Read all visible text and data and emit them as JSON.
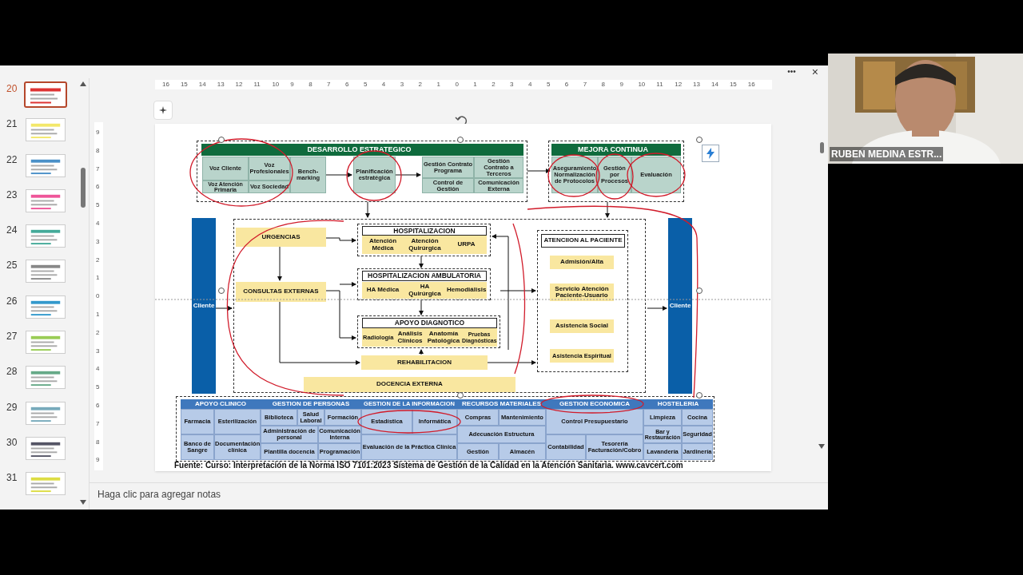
{
  "toolbar": {
    "more": "•••",
    "close": "×"
  },
  "thumbnails": [
    {
      "number": "20",
      "selected": true
    },
    {
      "number": "21",
      "selected": false
    },
    {
      "number": "22",
      "selected": false
    },
    {
      "number": "23",
      "selected": false
    },
    {
      "number": "24",
      "selected": false
    },
    {
      "number": "25",
      "selected": false
    },
    {
      "number": "26",
      "selected": false
    },
    {
      "number": "27",
      "selected": false
    },
    {
      "number": "28",
      "selected": false
    },
    {
      "number": "29",
      "selected": false
    },
    {
      "number": "30",
      "selected": false
    },
    {
      "number": "31",
      "selected": false
    }
  ],
  "ruler": {
    "horizontal": [
      "16",
      "15",
      "14",
      "13",
      "12",
      "11",
      "10",
      "9",
      "8",
      "7",
      "6",
      "5",
      "4",
      "3",
      "2",
      "1",
      "0",
      "1",
      "2",
      "3",
      "4",
      "5",
      "6",
      "7",
      "8",
      "9",
      "10",
      "11",
      "12",
      "13",
      "14",
      "15",
      "16"
    ],
    "vertical": [
      "9",
      "8",
      "7",
      "6",
      "5",
      "4",
      "3",
      "2",
      "1",
      "0",
      "1",
      "2",
      "3",
      "4",
      "5",
      "6",
      "7",
      "8",
      "9"
    ]
  },
  "diagram": [
    {
      "kind": "band-green",
      "text": "DESARROLLO ESTRATEGICO"
    },
    {
      "kind": "teal",
      "text": "Voz Cliente"
    },
    {
      "kind": "teal",
      "text": "Voz Profesionales"
    },
    {
      "kind": "teal",
      "text": "Voz Atención Primaria"
    },
    {
      "kind": "teal",
      "text": "Voz Sociedad"
    },
    {
      "kind": "teal",
      "text": "Bench-marking"
    },
    {
      "kind": "teal",
      "text": "Planificación estratégica"
    },
    {
      "kind": "teal",
      "text": "Gestión Contrato Programa"
    },
    {
      "kind": "teal",
      "text": "Gestión Contrato a Terceros"
    },
    {
      "kind": "teal",
      "text": "Control de Gestión"
    },
    {
      "kind": "teal",
      "text": "Comunicación Externa"
    },
    {
      "kind": "band-green",
      "text": "MEJORA CONTINUA"
    },
    {
      "kind": "teal",
      "text": "Aseguramiento Normalización de Protocolos"
    },
    {
      "kind": "teal",
      "text": "Gestión por Procesos"
    },
    {
      "kind": "teal",
      "text": "Evaluación"
    },
    {
      "kind": "client",
      "text": "Cliente"
    },
    {
      "kind": "client",
      "text": "Cliente"
    },
    {
      "kind": "yellow",
      "text": "URGENCIAS"
    },
    {
      "kind": "yellow",
      "text": "CONSULTAS EXTERNAS"
    },
    {
      "kind": "title",
      "text": "HOSPITALIZACION"
    },
    {
      "kind": "yellow",
      "text": "Atención Médica"
    },
    {
      "kind": "yellow",
      "text": "Atención Quirúrgica"
    },
    {
      "kind": "yellow",
      "text": "URPA"
    },
    {
      "kind": "title",
      "text": "HOSPITALIZACION AMBULATORIA"
    },
    {
      "kind": "yellow",
      "text": "HA Médica"
    },
    {
      "kind": "yellow",
      "text": "HA Quirúrgica"
    },
    {
      "kind": "yellow",
      "text": "Hemodiálisis"
    },
    {
      "kind": "title",
      "text": "APOYO DIAGNOTICO"
    },
    {
      "kind": "yellow",
      "text": "Radiología"
    },
    {
      "kind": "yellow",
      "text": "Análisis Clínicos"
    },
    {
      "kind": "yellow",
      "text": "Anatomía Patológica"
    },
    {
      "kind": "yellow",
      "text": "Pruebas Diagnósticas"
    },
    {
      "kind": "yellow",
      "text": "REHABILITACION"
    },
    {
      "kind": "yellow",
      "text": "DOCENCIA EXTERNA"
    },
    {
      "kind": "title",
      "text": "ATENCIION AL PACIENTE"
    },
    {
      "kind": "yellow",
      "text": "Admisión/Alta"
    },
    {
      "kind": "yellow",
      "text": "Servicio Atención Paciente-Usuario"
    },
    {
      "kind": "yellow",
      "text": "Asistencia Social"
    },
    {
      "kind": "yellow",
      "text": "Asistencia Espiritual"
    },
    {
      "kind": "band-blue",
      "text": "APOYO CLINICO"
    },
    {
      "kind": "band-blue",
      "text": "GESTION DE PERSONAS"
    },
    {
      "kind": "band-blue",
      "text": "GESTION DE LA INFORMACION"
    },
    {
      "kind": "band-blue",
      "text": "RECURSOS MATERIALES"
    },
    {
      "kind": "band-blue",
      "text": "GESTION ECONOMICA"
    },
    {
      "kind": "band-blue",
      "text": "HOSTELERIA"
    },
    {
      "kind": "blue",
      "text": "Farmacia"
    },
    {
      "kind": "blue",
      "text": "Esterilización"
    },
    {
      "kind": "blue",
      "text": "Banco de Sangre"
    },
    {
      "kind": "blue",
      "text": "Documentación clínica"
    },
    {
      "kind": "blue",
      "text": "Biblioteca"
    },
    {
      "kind": "blue",
      "text": "Salud Laboral"
    },
    {
      "kind": "blue",
      "text": "Formación"
    },
    {
      "kind": "blue",
      "text": "Administración de personal"
    },
    {
      "kind": "blue",
      "text": "Comunicación Interna"
    },
    {
      "kind": "blue",
      "text": "Plantilla docencia"
    },
    {
      "kind": "blue",
      "text": "Programación"
    },
    {
      "kind": "blue",
      "text": "Estadística"
    },
    {
      "kind": "blue",
      "text": "Informática"
    },
    {
      "kind": "blue",
      "text": "Evaluación de la Práctica Clínica"
    },
    {
      "kind": "blue",
      "text": "Compras"
    },
    {
      "kind": "blue",
      "text": "Mantenimiento"
    },
    {
      "kind": "blue",
      "text": "Adecuación Estructura"
    },
    {
      "kind": "blue",
      "text": "Gestión"
    },
    {
      "kind": "blue",
      "text": "Almacén"
    },
    {
      "kind": "blue",
      "text": "Control Presupuestario"
    },
    {
      "kind": "blue",
      "text": "Contabilidad"
    },
    {
      "kind": "blue",
      "text": "Tesorería Facturación/Cobro"
    },
    {
      "kind": "blue",
      "text": "Limpieza"
    },
    {
      "kind": "blue",
      "text": "Cocina"
    },
    {
      "kind": "blue",
      "text": "Bar y Restauración"
    },
    {
      "kind": "blue",
      "text": "Seguridad"
    },
    {
      "kind": "blue",
      "text": "Lavandería"
    },
    {
      "kind": "blue",
      "text": "Jardinería"
    }
  ],
  "source": "Fuente:  Curso: Interpretación de la Norma ISO 7101:2023 Sistema de Gestión de la Calidad  en la Atención Sanitaria. www.cavcert.com",
  "notes_placeholder": "Haga clic para agregar notas",
  "participant": {
    "name": "RUBEN MEDINA ESTR..."
  }
}
